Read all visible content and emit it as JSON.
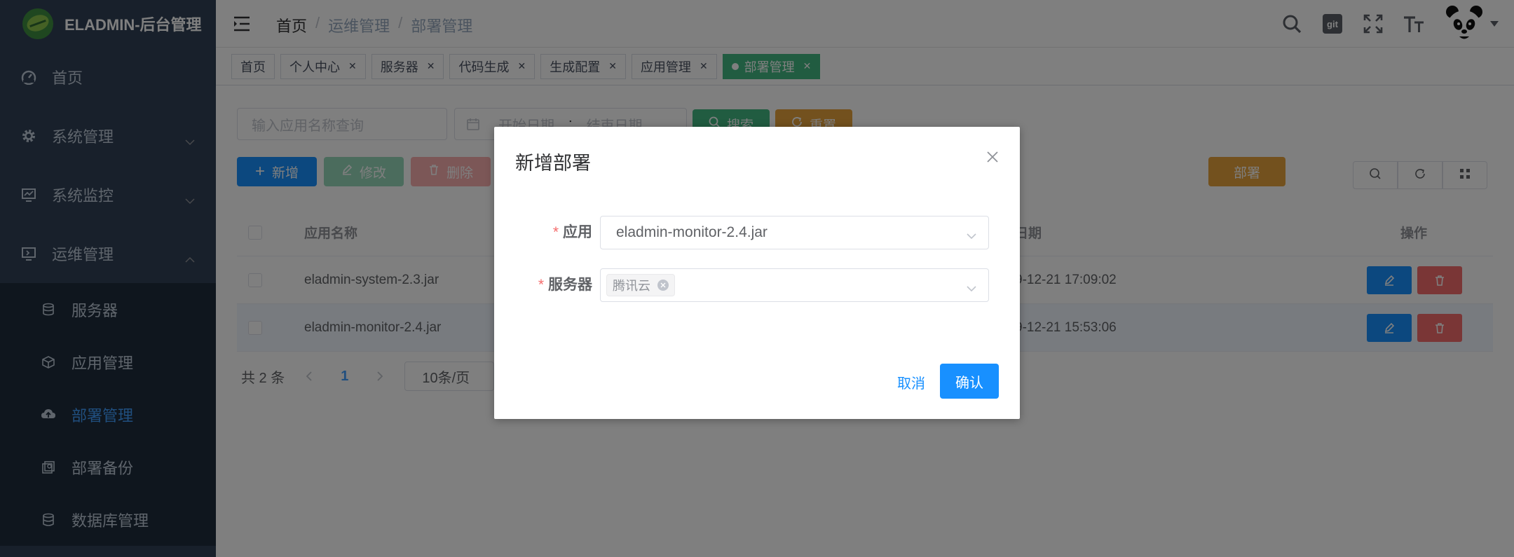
{
  "sidebar": {
    "logo_title": "ELADMIN-后台管理",
    "items": [
      {
        "label": "首页",
        "icon": "dashboard-icon"
      },
      {
        "label": "系统管理",
        "icon": "gear-icon"
      },
      {
        "label": "系统监控",
        "icon": "monitor-icon"
      },
      {
        "label": "运维管理",
        "icon": "ops-icon"
      }
    ],
    "subitems": [
      {
        "label": "服务器",
        "icon": "server-icon"
      },
      {
        "label": "应用管理",
        "icon": "app-icon"
      },
      {
        "label": "部署管理",
        "icon": "cloud-upload-icon",
        "active": true
      },
      {
        "label": "部署备份",
        "icon": "backup-icon"
      },
      {
        "label": "数据库管理",
        "icon": "database-icon"
      }
    ],
    "active_color": "#409eff",
    "bg_color": "#304156"
  },
  "navbar": {
    "breadcrumb": [
      "首页",
      "运维管理",
      "部署管理"
    ],
    "git_label": "git"
  },
  "tags": [
    {
      "label": "首页"
    },
    {
      "label": "个人中心"
    },
    {
      "label": "服务器"
    },
    {
      "label": "代码生成"
    },
    {
      "label": "生成配置"
    },
    {
      "label": "应用管理"
    },
    {
      "label": "部署管理",
      "active": true
    }
  ],
  "filters": {
    "search_placeholder": "输入应用名称查询",
    "start_date_placeholder": "开始日期",
    "range_sep": ":",
    "end_date_placeholder": "结束日期",
    "search_label": "搜索",
    "reset_label": "重置"
  },
  "toolbar": {
    "add_label": "新增",
    "edit_label": "修改",
    "delete_label": "删除",
    "deploy_label": "部署"
  },
  "table": {
    "columns": {
      "name": "应用名称",
      "date": "日期",
      "ops": "操作"
    },
    "rows": [
      {
        "name": "eladmin-system-2.3.jar",
        "date": "9-12-21 17:09:02"
      },
      {
        "name": "eladmin-monitor-2.4.jar",
        "date": "9-12-21 15:53:06"
      }
    ]
  },
  "pagination": {
    "total": "共 2 条",
    "current_page": "1",
    "page_size": "10条/页"
  },
  "dialog": {
    "title": "新增部署",
    "app_label": "应用",
    "app_value": "eladmin-monitor-2.4.jar",
    "server_label": "服务器",
    "server_tag": "腾讯云",
    "cancel_label": "取消",
    "confirm_label": "确认",
    "primary_color": "#1890ff"
  }
}
